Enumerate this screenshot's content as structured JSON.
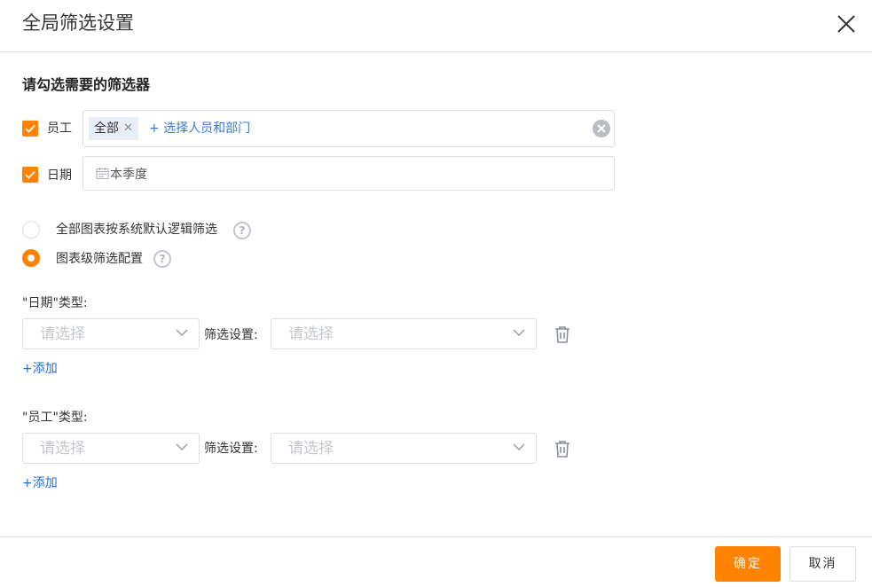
{
  "dialog": {
    "title": "全局筛选设置"
  },
  "section": {
    "title": "请勾选需要的筛选器"
  },
  "filters": {
    "employee": {
      "label": "员工",
      "checked": true,
      "tag": "全部",
      "add_text": "+ 选择人员和部门"
    },
    "date": {
      "label": "日期",
      "checked": true,
      "value": "本季度"
    }
  },
  "mode": {
    "options": [
      {
        "label": "全部图表按系统默认逻辑筛选",
        "selected": false
      },
      {
        "label": "图表级筛选配置",
        "selected": true
      }
    ],
    "help_glyph": "?"
  },
  "groups": {
    "date": {
      "label": "\"日期\"类型:",
      "type_placeholder": "请选择",
      "setting_label": "筛选设置:",
      "setting_placeholder": "请选择",
      "add_label": "+添加"
    },
    "employee": {
      "label": "\"员工\"类型:",
      "type_placeholder": "请选择",
      "setting_label": "筛选设置:",
      "setting_placeholder": "请选择",
      "add_label": "+添加"
    }
  },
  "footer": {
    "ok_label": "确定",
    "cancel_label": "取消"
  },
  "colors": {
    "accent": "#ff8200",
    "link": "#1f6fd1",
    "tag_bg": "#e8eef8"
  },
  "icons": [
    "close-icon",
    "check-icon",
    "tag-close-icon",
    "clear-icon",
    "calendar-icon",
    "help-icon",
    "chevron-down-icon",
    "trash-icon"
  ]
}
